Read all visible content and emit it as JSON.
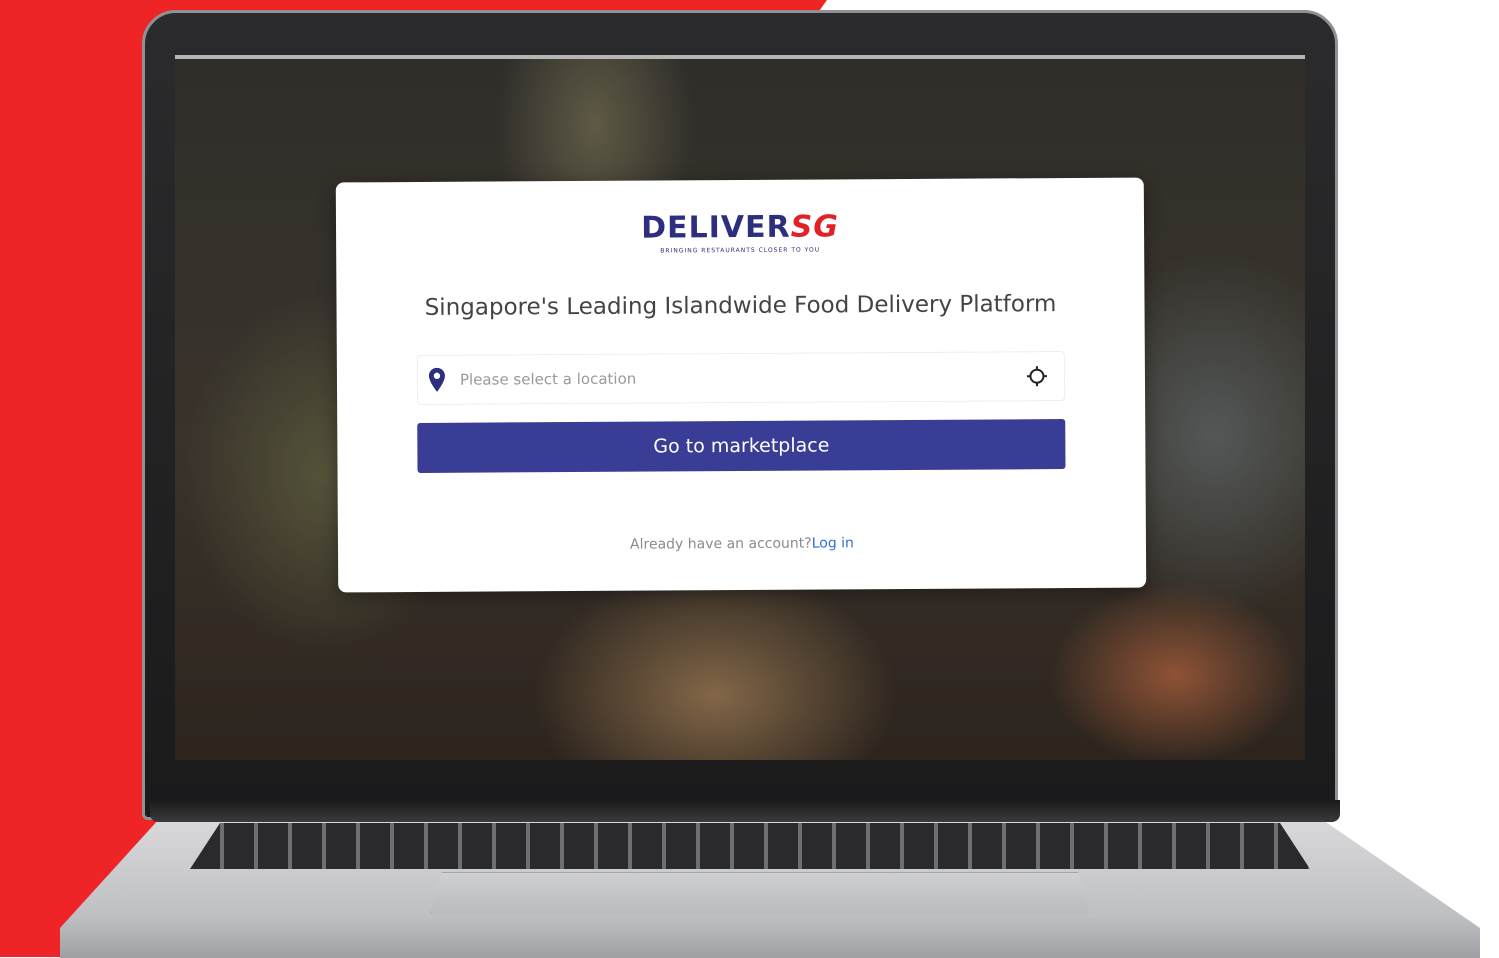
{
  "brand": {
    "logo_word": "DELIVER",
    "logo_suffix": "SG",
    "logo_tagline": "BRINGING RESTAURANTS CLOSER TO YOU"
  },
  "hero": {
    "headline": "Singapore's Leading Islandwide Food Delivery Platform"
  },
  "location": {
    "placeholder": "Please select a location",
    "value": ""
  },
  "cta": {
    "label": "Go to marketplace"
  },
  "auth": {
    "prompt": "Already have an account?",
    "login_label": "Log in"
  },
  "colors": {
    "primary": "#3a3d96",
    "link": "#2f6fd6",
    "backdrop_red": "#ee2427"
  },
  "icons": [
    "location-pin-icon",
    "locate-me-icon"
  ]
}
